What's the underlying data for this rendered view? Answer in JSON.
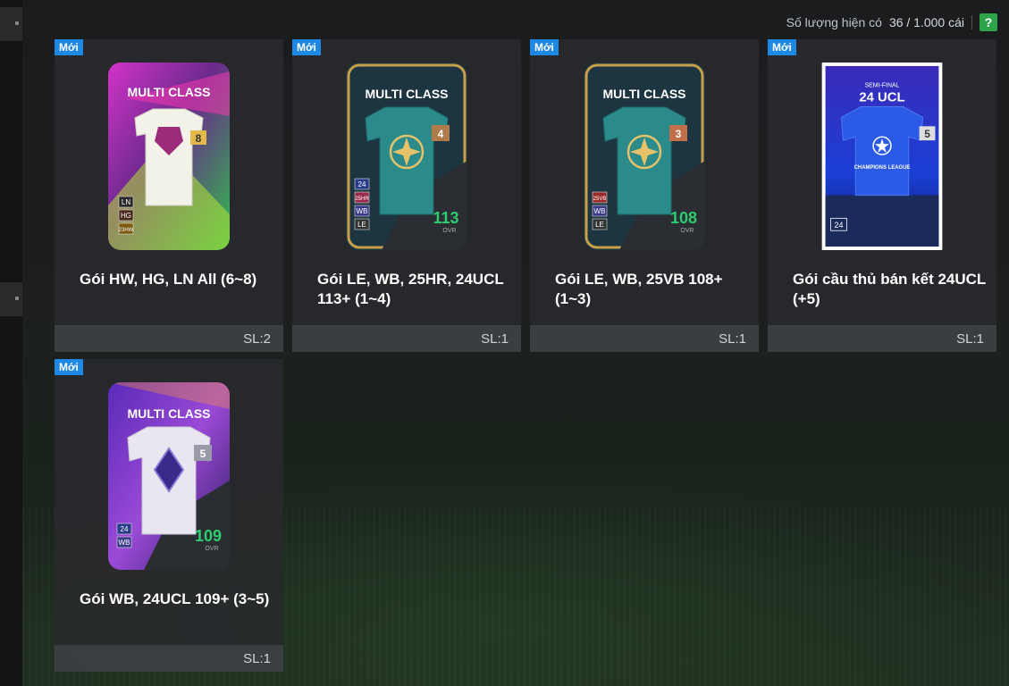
{
  "header": {
    "stock_label": "Số lượng hiện có",
    "stock_value": "36 / 1.000 cái",
    "help_label": "?"
  },
  "colors": {
    "accent_new": "#1e88e5",
    "help_green": "#2fa34a",
    "ovr_green": "#2ecc71"
  },
  "packs": [
    {
      "badge": "Mới",
      "name": "Gói HW, HG, LN All (6~8)",
      "quantity": "SL:2",
      "card": {
        "title": "MULTI CLASS",
        "level": "8",
        "tags": [
          "LN",
          "HG",
          "23HW"
        ],
        "ovr": "",
        "ovr_label": "",
        "theme": "purple-green"
      }
    },
    {
      "badge": "Mới",
      "name": "Gói LE, WB, 25HR, 24UCL 113+ (1~4)",
      "quantity": "SL:1",
      "card": {
        "title": "MULTI CLASS",
        "level": "4",
        "tags": [
          "24",
          "25HR",
          "WB",
          "LE"
        ],
        "ovr": "113",
        "ovr_label": "OVR",
        "theme": "teal-gold"
      }
    },
    {
      "badge": "Mới",
      "name": "Gói LE, WB, 25VB 108+ (1~3)",
      "quantity": "SL:1",
      "card": {
        "title": "MULTI CLASS",
        "level": "3",
        "tags": [
          "25VB",
          "WB",
          "LE"
        ],
        "ovr": "108",
        "ovr_label": "OVR",
        "theme": "teal-gold"
      }
    },
    {
      "badge": "Mới",
      "name": "Gói cầu thủ bán kết 24UCL (+5)",
      "quantity": "SL:1",
      "card": {
        "title_top": "SEMI-FINAL",
        "title": "24 UCL",
        "level": "5",
        "league": "CHAMPIONS LEAGUE",
        "tags": [
          "24"
        ],
        "theme": "ucl-blue"
      }
    },
    {
      "badge": "Mới",
      "name": "Gói WB, 24UCL 109+ (3~5)",
      "quantity": "SL:1",
      "card": {
        "title": "MULTI CLASS",
        "level": "5",
        "tags": [
          "24",
          "WB"
        ],
        "ovr": "109",
        "ovr_label": "OVR",
        "theme": "purple-silver"
      }
    }
  ]
}
